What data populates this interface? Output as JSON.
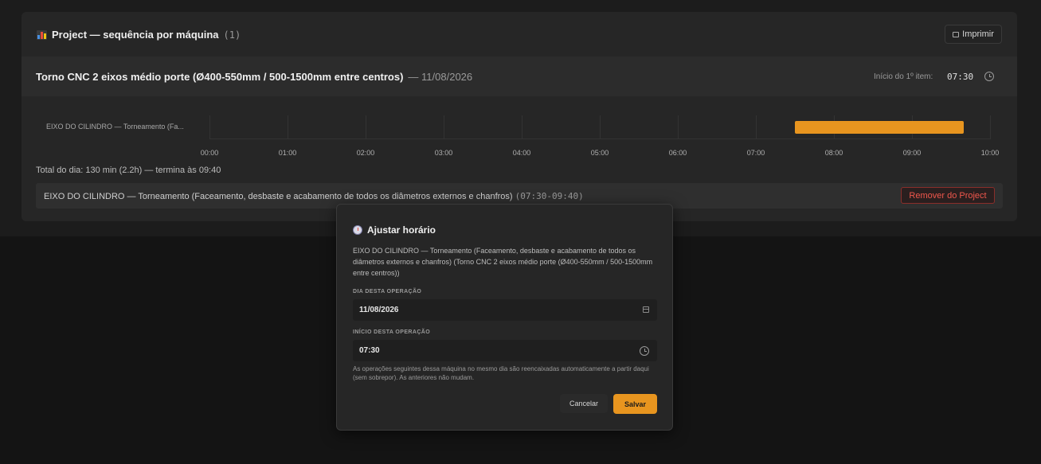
{
  "panel": {
    "title": "Project — sequência por máquina",
    "count": "(1)",
    "print_label": "Imprimir"
  },
  "machine": {
    "name": "Torno CNC 2 eixos médio porte (Ø400-550mm / 500-1500mm entre centros)",
    "date": "— 11/08/2026",
    "start_label": "Início do 1º item:",
    "start_time": "07:30"
  },
  "chart_data": {
    "type": "bar",
    "orientation": "horizontal-timeline",
    "categories": [
      "EIXO DO CILINDRO — Torneamento (Fa..."
    ],
    "series": [
      {
        "start": "07:30",
        "end": "09:40"
      }
    ],
    "xlim": [
      "00:00",
      "10:00"
    ],
    "ticks": [
      "00:00",
      "01:00",
      "02:00",
      "03:00",
      "04:00",
      "05:00",
      "06:00",
      "07:00",
      "08:00",
      "09:00",
      "10:00"
    ],
    "grid": true
  },
  "summary": {
    "total": "Total do dia: 130 min (2.2h) — termina às 09:40"
  },
  "item": {
    "text": "EIXO DO CILINDRO — Torneamento (Faceamento, desbaste e acabamento de todos os diâmetros externos e chanfros)",
    "range": "(07:30-09:40)",
    "remove_label": "Remover do Project"
  },
  "modal": {
    "title": "Ajustar horário",
    "description": "EIXO DO CILINDRO — Torneamento (Faceamento, desbaste e acabamento de todos os diâmetros externos e chanfros) (Torno CNC 2 eixos médio porte (Ø400-550mm / 500-1500mm entre centros))",
    "day_label": "DIA DESTA OPERAÇÃO",
    "day_value": "11/08/2026",
    "start_label": "INÍCIO DESTA OPERAÇÃO",
    "start_value": "07:30",
    "hint": "As operações seguintes dessa máquina no mesmo dia são reencaixadas automaticamente a partir daqui (sem sobrepor). As anteriores não mudam.",
    "cancel_label": "Cancelar",
    "save_label": "Salvar"
  },
  "colors": {
    "accent": "#e8951f",
    "danger": "#f0574c"
  }
}
